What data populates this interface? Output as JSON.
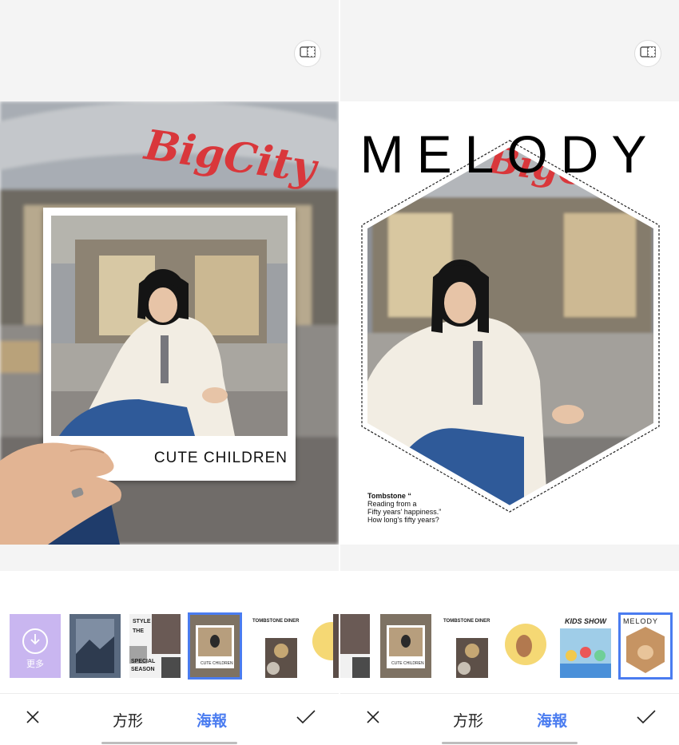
{
  "left_panel": {
    "polaroid_caption": "CUTE CHILDREN",
    "bottom_bar": {
      "tab_square": "方形",
      "tab_poster": "海報"
    }
  },
  "right_panel": {
    "poster_title": "MELODY",
    "poster_text": [
      "Tombstone “",
      "Reading from a",
      "Fifty years' happiness.”",
      "How long's fifty years?"
    ],
    "bottom_bar": {
      "tab_square": "方形",
      "tab_poster": "海報"
    }
  },
  "templates": {
    "more_label": "更多",
    "items": [
      {
        "id": "mountain"
      },
      {
        "id": "collage-season",
        "labels": [
          "STYLE",
          "THE",
          "SPECIAL",
          "SEASON"
        ]
      },
      {
        "id": "polaroid-cute-children",
        "selected": true,
        "labels": [
          "CUTE CHILDREN"
        ]
      },
      {
        "id": "tombstone-diner",
        "labels": [
          "TOMBSTONE DINER"
        ]
      },
      {
        "id": "hexagon-style"
      },
      {
        "id": "polaroid-cute-children-2",
        "labels": [
          "CUTE CHILDREN"
        ]
      },
      {
        "id": "tombstone-diner-2",
        "labels": [
          "TOMBSTONE DINER"
        ]
      },
      {
        "id": "circle-portrait"
      },
      {
        "id": "kids-show",
        "labels": [
          "KIDS SHOW"
        ]
      },
      {
        "id": "melody",
        "selected": true,
        "labels": [
          "MELODY"
        ]
      }
    ]
  },
  "colors": {
    "accent": "#4a7cf0",
    "more_tile": "#c9b6f0",
    "panel_bg": "#f4f4f4",
    "sign_red": "#d9373b"
  }
}
